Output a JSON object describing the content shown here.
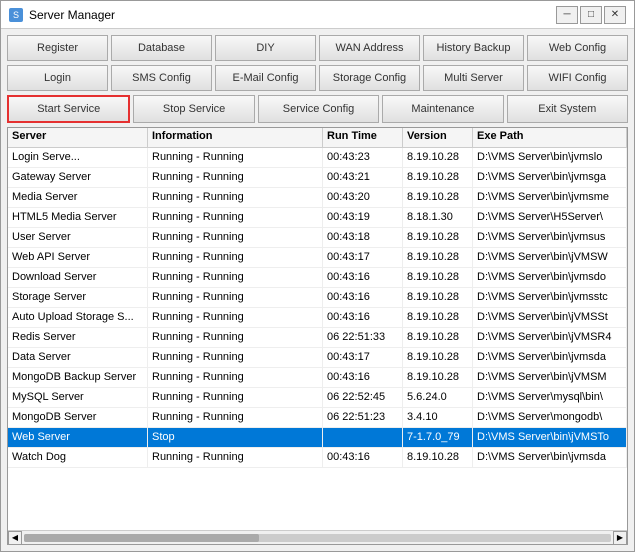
{
  "window": {
    "title": "Server Manager",
    "close_label": "✕",
    "minimize_label": "─",
    "maximize_label": "□"
  },
  "toolbar_row1": {
    "register": "Register",
    "database": "Database",
    "diy": "DIY",
    "wan_address": "WAN Address",
    "history_backup": "History Backup",
    "web_config": "Web Config"
  },
  "toolbar_row2": {
    "login": "Login",
    "sms_config": "SMS Config",
    "email_config": "E-Mail Config",
    "storage_config": "Storage Config",
    "multi_server": "Multi Server",
    "wifi_config": "WIFI Config"
  },
  "toolbar_row3": {
    "start_service": "Start Service",
    "stop_service": "Stop Service",
    "service_config": "Service Config",
    "maintenance": "Maintenance",
    "exit_system": "Exit System"
  },
  "table": {
    "headers": [
      "Server",
      "Information",
      "Run Time",
      "Version",
      "Exe Path"
    ],
    "rows": [
      {
        "server": "Login Serve...",
        "info": "Running - Running",
        "runtime": "00:43:23",
        "version": "8.19.10.28",
        "path": "D:\\VMS Server\\bin\\jvmslo"
      },
      {
        "server": "Gateway Server",
        "info": "Running - Running",
        "runtime": "00:43:21",
        "version": "8.19.10.28",
        "path": "D:\\VMS Server\\bin\\jvmsga"
      },
      {
        "server": "Media Server",
        "info": "Running - Running",
        "runtime": "00:43:20",
        "version": "8.19.10.28",
        "path": "D:\\VMS Server\\bin\\jvmsme"
      },
      {
        "server": "HTML5 Media Server",
        "info": "Running - Running",
        "runtime": "00:43:19",
        "version": "8.18.1.30",
        "path": "D:\\VMS Server\\H5Server\\"
      },
      {
        "server": "User Server",
        "info": "Running - Running",
        "runtime": "00:43:18",
        "version": "8.19.10.28",
        "path": "D:\\VMS Server\\bin\\jvmsus"
      },
      {
        "server": "Web API Server",
        "info": "Running - Running",
        "runtime": "00:43:17",
        "version": "8.19.10.28",
        "path": "D:\\VMS Server\\bin\\jVMSW"
      },
      {
        "server": "Download Server",
        "info": "Running - Running",
        "runtime": "00:43:16",
        "version": "8.19.10.28",
        "path": "D:\\VMS Server\\bin\\jvmsdo"
      },
      {
        "server": "Storage Server",
        "info": "Running - Running",
        "runtime": "00:43:16",
        "version": "8.19.10.28",
        "path": "D:\\VMS Server\\bin\\jvmsstc"
      },
      {
        "server": "Auto Upload Storage S...",
        "info": "Running - Running",
        "runtime": "00:43:16",
        "version": "8.19.10.28",
        "path": "D:\\VMS Server\\bin\\jVMSSt"
      },
      {
        "server": "Redis Server",
        "info": "Running - Running",
        "runtime": "06 22:51:33",
        "version": "8.19.10.28",
        "path": "D:\\VMS Server\\bin\\jVMSR4"
      },
      {
        "server": "Data Server",
        "info": "Running - Running",
        "runtime": "00:43:17",
        "version": "8.19.10.28",
        "path": "D:\\VMS Server\\bin\\jvmsda"
      },
      {
        "server": "MongoDB Backup Server",
        "info": "Running - Running",
        "runtime": "00:43:16",
        "version": "8.19.10.28",
        "path": "D:\\VMS Server\\bin\\jVMSM"
      },
      {
        "server": "MySQL Server",
        "info": "Running - Running",
        "runtime": "06 22:52:45",
        "version": "5.6.24.0",
        "path": "D:\\VMS Server\\mysql\\bin\\"
      },
      {
        "server": "MongoDB Server",
        "info": "Running - Running",
        "runtime": "06 22:51:23",
        "version": "3.4.10",
        "path": "D:\\VMS Server\\mongodb\\"
      },
      {
        "server": "Web Server",
        "info": "Stop",
        "runtime": "",
        "version": "7-1.7.0_79",
        "path": "D:\\VMS Server\\bin\\jVMSTo",
        "selected": true
      },
      {
        "server": "Watch Dog",
        "info": "Running - Running",
        "runtime": "00:43:16",
        "version": "8.19.10.28",
        "path": "D:\\VMS Server\\bin\\jvmsda"
      }
    ]
  }
}
